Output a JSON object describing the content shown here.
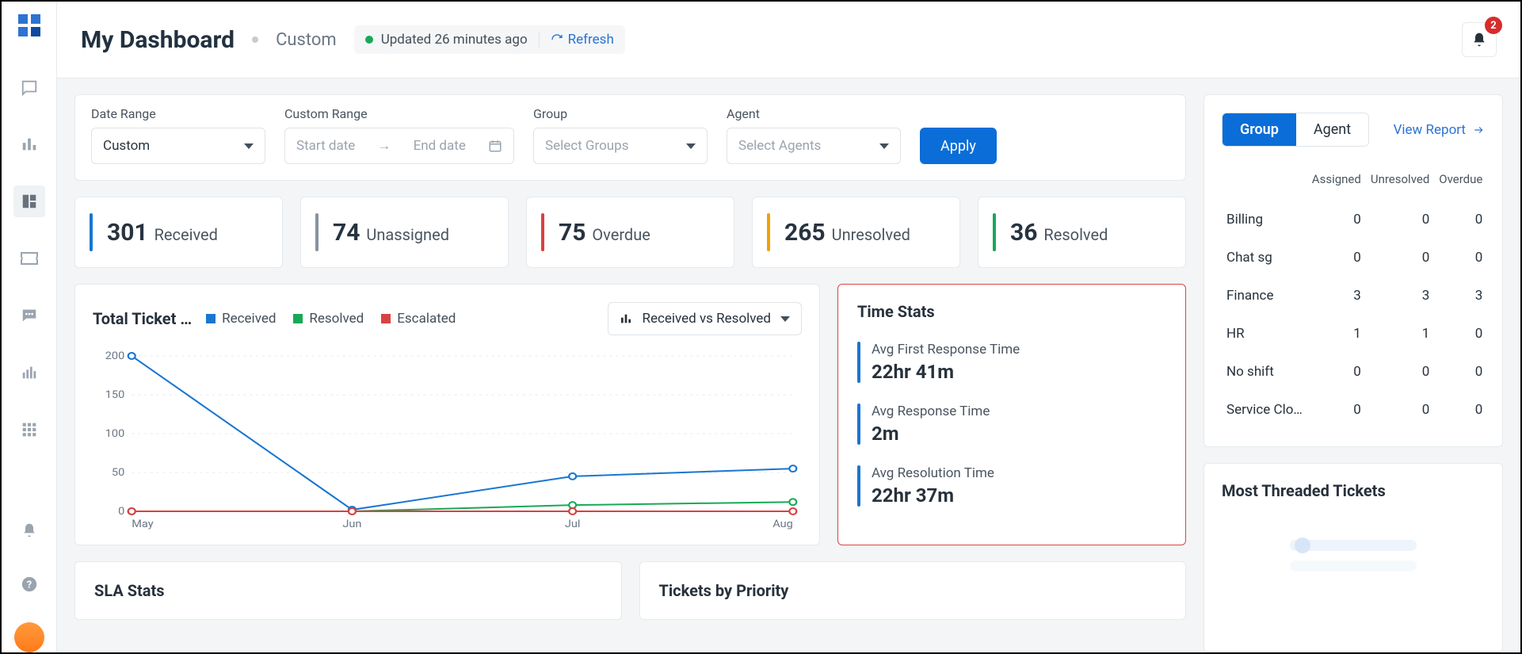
{
  "header": {
    "title": "My Dashboard",
    "subtitle": "Custom",
    "updated_text": "Updated 26 minutes ago",
    "refresh_label": "Refresh",
    "notification_count": "2"
  },
  "filters": {
    "date_range_label": "Date Range",
    "date_range_value": "Custom",
    "custom_range_label": "Custom Range",
    "custom_range_start_placeholder": "Start date",
    "custom_range_end_placeholder": "End date",
    "group_label": "Group",
    "group_placeholder": "Select Groups",
    "agent_label": "Agent",
    "agent_placeholder": "Select Agents",
    "apply_label": "Apply"
  },
  "stats": [
    {
      "value": "301",
      "label": "Received",
      "color": "#1976d2"
    },
    {
      "value": "74",
      "label": "Unassigned",
      "color": "#8892a0"
    },
    {
      "value": "75",
      "label": "Overdue",
      "color": "#d94141"
    },
    {
      "value": "265",
      "label": "Unresolved",
      "color": "#f2a100"
    },
    {
      "value": "36",
      "label": "Resolved",
      "color": "#18a957"
    }
  ],
  "chart": {
    "title": "Total Ticket …",
    "legend_received": "Received",
    "legend_resolved": "Resolved",
    "legend_escalated": "Escalated",
    "selector_label": "Received vs Resolved"
  },
  "time_stats": {
    "title": "Time Stats",
    "items": [
      {
        "label": "Avg First Response Time",
        "value": "22hr 41m"
      },
      {
        "label": "Avg Response Time",
        "value": "2m"
      },
      {
        "label": "Avg Resolution Time",
        "value": "22hr 37m"
      }
    ]
  },
  "bottom": {
    "sla": "SLA Stats",
    "priority": "Tickets by Priority"
  },
  "side_panel": {
    "tab_group": "Group",
    "tab_agent": "Agent",
    "view_report": "View Report",
    "headers": {
      "assigned": "Assigned",
      "unresolved": "Unresolved",
      "overdue": "Overdue"
    },
    "rows": [
      {
        "name": "Billing",
        "assigned": "0",
        "unresolved": "0",
        "overdue": "0"
      },
      {
        "name": "Chat sg",
        "assigned": "0",
        "unresolved": "0",
        "overdue": "0"
      },
      {
        "name": "Finance",
        "assigned": "3",
        "unresolved": "3",
        "overdue": "3"
      },
      {
        "name": "HR",
        "assigned": "1",
        "unresolved": "1",
        "overdue": "0"
      },
      {
        "name": "No shift",
        "assigned": "0",
        "unresolved": "0",
        "overdue": "0"
      },
      {
        "name": "Service Clo…",
        "assigned": "0",
        "unresolved": "0",
        "overdue": "0"
      }
    ],
    "most_threaded_title": "Most Threaded Tickets"
  },
  "chart_data": {
    "type": "line",
    "categories": [
      "May",
      "Jun",
      "Jul",
      "Aug"
    ],
    "series": [
      {
        "name": "Received",
        "color": "#1976d2",
        "values": [
          200,
          2,
          45,
          55
        ]
      },
      {
        "name": "Resolved",
        "color": "#18a957",
        "values": [
          0,
          0,
          8,
          12
        ]
      },
      {
        "name": "Escalated",
        "color": "#d94141",
        "values": [
          0,
          0,
          0,
          0
        ]
      }
    ],
    "ylabel": "",
    "xlabel": "",
    "ylim": [
      0,
      200
    ],
    "yticks": [
      0,
      50,
      100,
      150,
      200
    ]
  }
}
